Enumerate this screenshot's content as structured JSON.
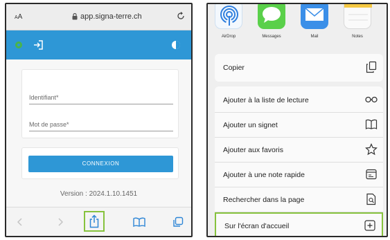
{
  "left_phone": {
    "address_bar": {
      "aa_label": "AA",
      "url": "app.signa-terre.ch"
    },
    "login_form": {
      "identifiant_label": "Identifiant*",
      "password_label": "Mot de passe*",
      "submit_label": "CONNEXION"
    },
    "version_text": "Version : 2024.1.10.1451",
    "toolbar": {
      "items": [
        "back-icon",
        "forward-icon",
        "share-icon",
        "bookmarks-icon",
        "tabs-icon"
      ]
    },
    "colors": {
      "header": "#2e97d6",
      "button": "#2e97d6",
      "highlight": "#86c23d"
    }
  },
  "right_phone": {
    "apps": [
      {
        "label": "AirDrop",
        "icon": "airdrop-icon"
      },
      {
        "label": "Messages",
        "icon": "messages-icon"
      },
      {
        "label": "Mail",
        "icon": "mail-icon"
      },
      {
        "label": "Notes",
        "icon": "notes-icon"
      }
    ],
    "menu": [
      {
        "label": "Copier",
        "icon": "copy-icon"
      },
      {
        "label": "Ajouter à la liste de lecture",
        "icon": "glasses-icon"
      },
      {
        "label": "Ajouter un signet",
        "icon": "book-icon"
      },
      {
        "label": "Ajouter aux favoris",
        "icon": "star-icon"
      },
      {
        "label": "Ajouter à une note rapide",
        "icon": "quick-note-icon"
      },
      {
        "label": "Rechercher dans la page",
        "icon": "find-in-page-icon"
      },
      {
        "label": "Sur l'écran d'accueil",
        "icon": "add-to-home-icon"
      }
    ]
  }
}
